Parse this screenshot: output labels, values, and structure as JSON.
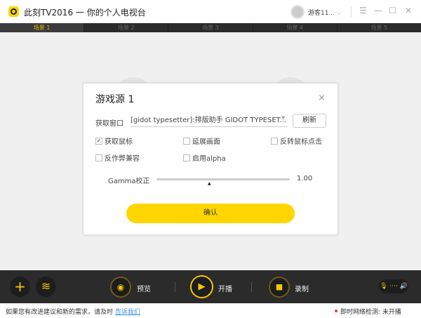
{
  "app": {
    "title": "此刻TV2016 一 你的个人电视台",
    "user": "游客11...",
    "user_chevron": "⌵",
    "menu": "☰",
    "minimize": "—",
    "maximize": "☐",
    "close": "✕"
  },
  "scenes": [
    {
      "label": "场景 1",
      "active": true
    },
    {
      "label": "场景 2"
    },
    {
      "label": "场景 3"
    },
    {
      "label": "场景 4"
    },
    {
      "label": "场景 5"
    }
  ],
  "dialog": {
    "title": "游戏源 1",
    "close": "×",
    "window_label": "获取窗口",
    "window_value": "[gidot  typesetter]:排版助手  GIDOT  TYPESET...",
    "dropdown_arrow": "▼",
    "refresh": "刷新",
    "checkboxes": [
      {
        "label": "获取鼠标",
        "checked": true
      },
      {
        "label": "延展画面",
        "checked": false
      },
      {
        "label": "反转鼠标点击",
        "checked": false
      },
      {
        "label": "反作弊兼容",
        "checked": false
      },
      {
        "label": "启用alpha",
        "checked": false
      }
    ],
    "gamma_label": "Gamma校正",
    "gamma_value": "1.00",
    "gamma_fraction": 0.4,
    "confirm": "确认"
  },
  "toolbar": {
    "add": "+",
    "layers": "≋",
    "preview": "预览",
    "live": "开播",
    "record": "录制",
    "audio": "🎙 ···· 🔊"
  },
  "status": {
    "feedback": "如果您有改进建议和新的需求，请及时",
    "feedback_link": "告诉我们",
    "network": "即时网络检测: 未开播"
  }
}
